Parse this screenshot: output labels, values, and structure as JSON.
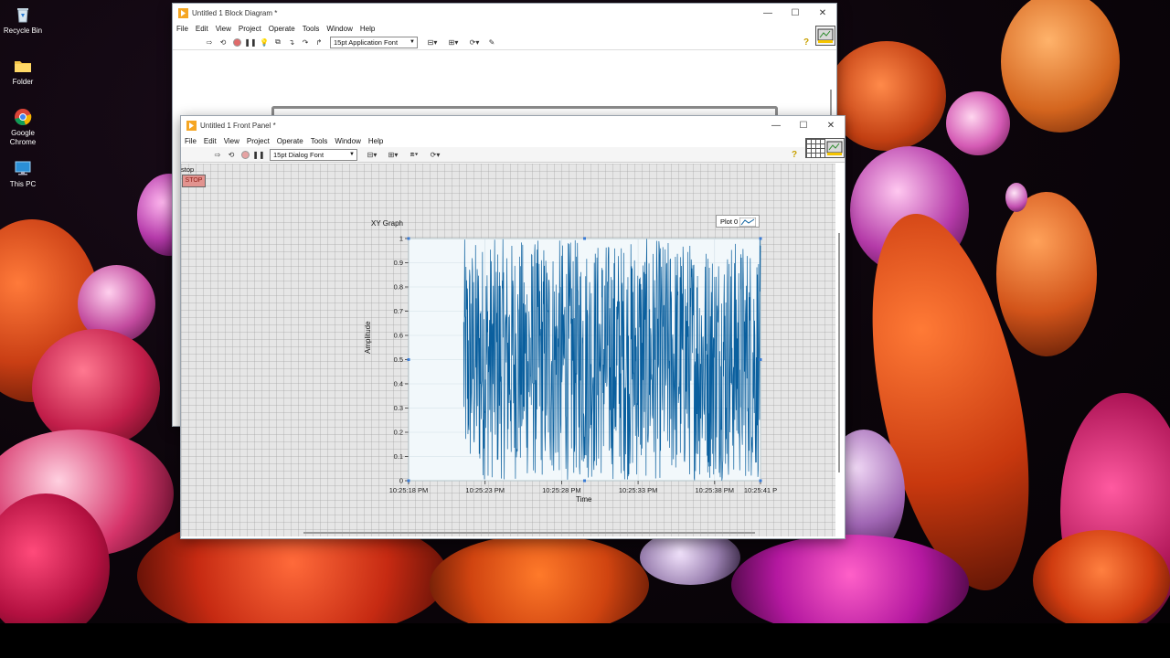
{
  "desktop": {
    "icons": [
      {
        "label": "Recycle Bin",
        "icon": "recycle-bin-icon"
      },
      {
        "label": "Folder",
        "icon": "folder-icon"
      },
      {
        "label": "Google Chrome",
        "icon": "chrome-icon"
      },
      {
        "label": "This PC",
        "icon": "monitor-icon"
      }
    ]
  },
  "block_diagram": {
    "title": "Untitled 1 Block Diagram *",
    "menu": [
      "File",
      "Edit",
      "View",
      "Project",
      "Operate",
      "Tools",
      "Window",
      "Help"
    ],
    "font_selector": "15pt Application Font"
  },
  "front_panel": {
    "title": "Untitled 1 Front Panel *",
    "menu": [
      "File",
      "Edit",
      "View",
      "Project",
      "Operate",
      "Tools",
      "Window",
      "Help"
    ],
    "font_selector": "15pt Dialog Font",
    "stop_label": "stop",
    "stop_button": "STOP"
  },
  "colors": {
    "accent": "#0a5f9e",
    "plot_bg": "#f2f8fb",
    "panel_bg": "#e6e6e6",
    "stop_button": "#e2938f"
  },
  "chart_data": {
    "type": "line",
    "title": "XY Graph",
    "xlabel": "Time",
    "ylabel": "Amplitude",
    "legend": [
      "Plot 0"
    ],
    "legend_position": "top-right",
    "x_ticks": [
      "10:25:18 PM",
      "10:25:23 PM",
      "10:25:28 PM",
      "10:25:33 PM",
      "10:25:38 PM",
      "10:25:41 P"
    ],
    "y_ticks": [
      "0",
      "0.1",
      "0.2",
      "0.3",
      "0.4",
      "0.5",
      "0.6",
      "0.7",
      "0.8",
      "0.9",
      "1"
    ],
    "ylim": [
      0,
      1
    ],
    "xlim_seconds": [
      0,
      23
    ],
    "grid": true,
    "series": [
      {
        "name": "Plot 0",
        "description": "uniform random values between 0 and 1 sampled densely from 10:25:22 PM to 10:25:41 PM"
      }
    ],
    "data_start_seconds": 3.6,
    "data_end_seconds": 23
  }
}
